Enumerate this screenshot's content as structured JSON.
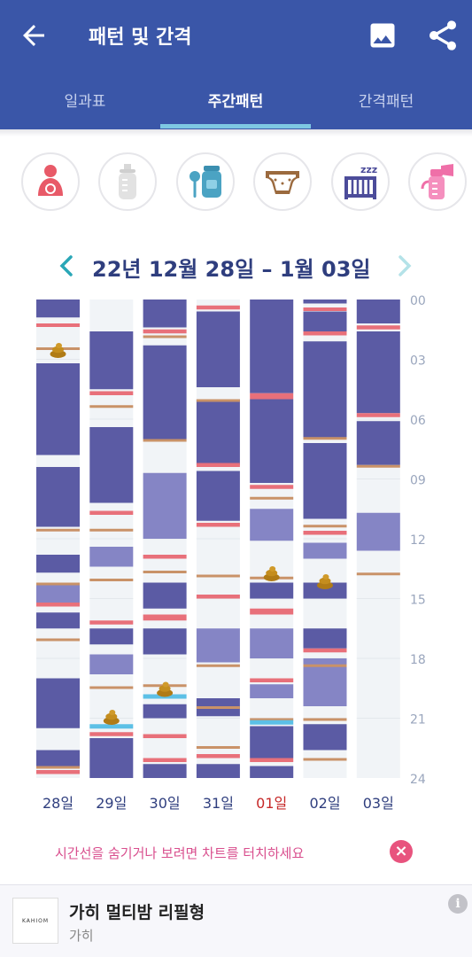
{
  "appbar": {
    "title": "패턴 및 간격",
    "back_icon": "arrow-left-icon",
    "image_icon": "image-icon",
    "share_icon": "share-icon"
  },
  "tabs": [
    {
      "label": "일과표",
      "active": false
    },
    {
      "label": "주간패턴",
      "active": true
    },
    {
      "label": "간격패턴",
      "active": false
    }
  ],
  "categories": [
    {
      "icon": "breastfeeding-icon"
    },
    {
      "icon": "bottle-icon"
    },
    {
      "icon": "baby-food-icon"
    },
    {
      "icon": "diaper-icon"
    },
    {
      "icon": "sleep-crib-icon"
    },
    {
      "icon": "breast-pump-icon"
    }
  ],
  "date_range": "22년 12월 28일 – 1월 03일",
  "colors": {
    "sleep": "#5b5ba4",
    "sleep_light": "#8585c5",
    "feed": "#e8707a",
    "food": "#c99268",
    "bath": "#5cc0e6",
    "day_bg": "#f1f4f7",
    "today_label": "#c62828",
    "label": "#2f3e7e"
  },
  "chart_data": {
    "type": "timeline",
    "y_ticks": [
      "00",
      "03",
      "06",
      "09",
      "12",
      "15",
      "18",
      "21",
      "24"
    ],
    "ylim": [
      0,
      24
    ],
    "days": [
      {
        "label": "28일",
        "today": false,
        "sleep": [
          [
            0,
            0.9
          ],
          [
            3.2,
            7.8
          ],
          [
            8.4,
            11.4
          ],
          [
            12.8,
            13.7
          ],
          [
            15.7,
            16.5
          ],
          [
            19.0,
            21.5
          ],
          [
            22.6,
            23.4
          ]
        ],
        "sleep_light": [
          [
            14.3,
            15.4
          ]
        ],
        "feed": [
          [
            1.2,
            1.3
          ],
          [
            15.2,
            15.4
          ],
          [
            23.6,
            23.8
          ]
        ],
        "food": [
          [
            2.4,
            2.5
          ],
          [
            11.5,
            11.6
          ],
          [
            14.2,
            14.3
          ],
          [
            17.0,
            17.1
          ],
          [
            23.4,
            23.5
          ]
        ],
        "poop": [
          2.6
        ]
      },
      {
        "label": "29일",
        "today": false,
        "sleep": [
          [
            1.6,
            4.5
          ],
          [
            6.4,
            10.2
          ],
          [
            16.5,
            17.3
          ],
          [
            22.0,
            24.0
          ]
        ],
        "sleep_light": [
          [
            12.4,
            13.4
          ],
          [
            17.8,
            18.8
          ]
        ],
        "feed": [
          [
            4.6,
            4.8
          ],
          [
            10.6,
            10.8
          ],
          [
            16.1,
            16.3
          ],
          [
            21.7,
            21.9
          ]
        ],
        "food": [
          [
            5.3,
            5.4
          ],
          [
            11.5,
            11.6
          ],
          [
            14.0,
            14.1
          ],
          [
            19.4,
            19.5
          ]
        ],
        "bath": [
          [
            21.3,
            21.5
          ]
        ],
        "poop": [
          21.0
        ]
      },
      {
        "label": "30일",
        "today": false,
        "sleep": [
          [
            0.0,
            1.4
          ],
          [
            2.3,
            7.0
          ],
          [
            14.2,
            15.5
          ],
          [
            16.5,
            17.8
          ],
          [
            20.3,
            21.0
          ],
          [
            23.3,
            24.0
          ]
        ],
        "sleep_light": [
          [
            8.7,
            12.0
          ]
        ],
        "feed": [
          [
            1.5,
            1.7
          ],
          [
            12.8,
            13.0
          ],
          [
            15.8,
            16.1
          ],
          [
            21.8,
            22.0
          ],
          [
            23.0,
            23.2
          ]
        ],
        "food": [
          [
            1.8,
            1.9
          ],
          [
            7.0,
            7.2
          ],
          [
            13.6,
            13.7
          ],
          [
            19.3,
            19.4
          ]
        ],
        "bath": [
          [
            19.8,
            20.1
          ]
        ],
        "poop": [
          19.6
        ]
      },
      {
        "label": "31일",
        "today": false,
        "sleep": [
          [
            0.6,
            4.4
          ],
          [
            5.0,
            8.3
          ],
          [
            8.6,
            11.1
          ],
          [
            20.0,
            20.9
          ],
          [
            23.3,
            24.0
          ]
        ],
        "sleep_light": [
          [
            16.5,
            18.2
          ]
        ],
        "feed": [
          [
            0.3,
            0.5
          ],
          [
            8.2,
            8.4
          ],
          [
            11.2,
            11.4
          ],
          [
            14.8,
            15.0
          ],
          [
            22.8,
            23.0
          ]
        ],
        "food": [
          [
            5.0,
            5.1
          ],
          [
            13.8,
            13.9
          ],
          [
            18.3,
            18.4
          ],
          [
            20.4,
            20.5
          ],
          [
            22.4,
            22.5
          ]
        ],
        "poop": []
      },
      {
        "label": "01일",
        "today": true,
        "sleep": [
          [
            0.0,
            4.7
          ],
          [
            5.0,
            9.2
          ],
          [
            14.2,
            15.0
          ],
          [
            21.4,
            23.0
          ],
          [
            23.4,
            24.0
          ]
        ],
        "sleep_light": [
          [
            10.5,
            12.1
          ],
          [
            16.5,
            18.0
          ],
          [
            19.3,
            20.0
          ]
        ],
        "feed": [
          [
            4.7,
            5.0
          ],
          [
            9.3,
            9.5
          ],
          [
            15.5,
            15.8
          ],
          [
            19.0,
            19.2
          ],
          [
            23.0,
            23.2
          ]
        ],
        "food": [
          [
            9.9,
            10.0
          ],
          [
            13.9,
            14.0
          ],
          [
            21.0,
            21.1
          ]
        ],
        "bath": [
          [
            21.1,
            21.3
          ]
        ],
        "poop": [
          13.8
        ]
      },
      {
        "label": "02일",
        "today": false,
        "sleep": [
          [
            0.0,
            0.2
          ],
          [
            0.6,
            1.6
          ],
          [
            2.1,
            7.0
          ],
          [
            7.2,
            11.0
          ],
          [
            14.2,
            15.0
          ],
          [
            16.5,
            17.5
          ],
          [
            21.3,
            22.6
          ]
        ],
        "sleep_light": [
          [
            12.2,
            13.0
          ],
          [
            18.0,
            20.4
          ]
        ],
        "feed": [
          [
            0.4,
            0.5
          ],
          [
            1.6,
            1.8
          ],
          [
            11.6,
            11.8
          ],
          [
            17.5,
            17.7
          ]
        ],
        "food": [
          [
            6.9,
            7.1
          ],
          [
            11.3,
            11.4
          ],
          [
            18.3,
            18.4
          ],
          [
            21.0,
            21.1
          ],
          [
            23.0,
            23.1
          ]
        ],
        "poop": [
          14.2
        ]
      },
      {
        "label": "03일",
        "today": false,
        "sleep": [
          [
            0.0,
            1.2
          ],
          [
            1.6,
            5.7
          ],
          [
            6.1,
            8.3
          ]
        ],
        "sleep_light": [
          [
            10.7,
            12.6
          ]
        ],
        "feed": [
          [
            1.3,
            1.5
          ],
          [
            5.7,
            5.9
          ]
        ],
        "food": [
          [
            8.3,
            8.4
          ],
          [
            13.7,
            13.8
          ]
        ],
        "poop": []
      }
    ]
  },
  "hint": {
    "text": "시간선을 숨기거나 보려면 차트를 터치하세요",
    "close_icon": "close-icon"
  },
  "ad": {
    "logo_text": "KAHIOM",
    "title": "가히 멀티밤 리필형",
    "brand": "가히",
    "info_icon": "info-icon"
  }
}
